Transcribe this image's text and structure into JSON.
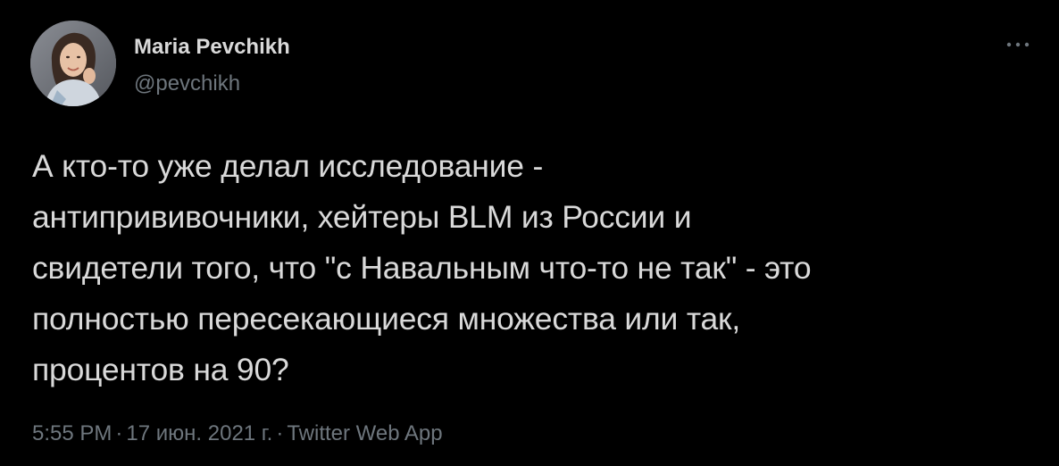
{
  "author": {
    "display_name": "Maria Pevchikh",
    "handle": "@pevchikh"
  },
  "tweet": {
    "lines": [
      "А кто-то уже делал исследование -",
      "антипрививочники, хейтеры BLM из России и",
      "свидетели того, что \"с Навальным что-то не так\" - это",
      "полностью пересекающиеся множества или так,",
      "процентов на 90?"
    ]
  },
  "meta": {
    "time": "5:55 PM",
    "date": "17 июн. 2021 г.",
    "separator": "·",
    "source": "Twitter Web App"
  },
  "icons": {
    "more": "more-horizontal-icon",
    "avatar": "profile-photo"
  },
  "colors": {
    "background": "#000000",
    "primary_text": "#d9d9d9",
    "secondary_text": "#6e767d"
  }
}
